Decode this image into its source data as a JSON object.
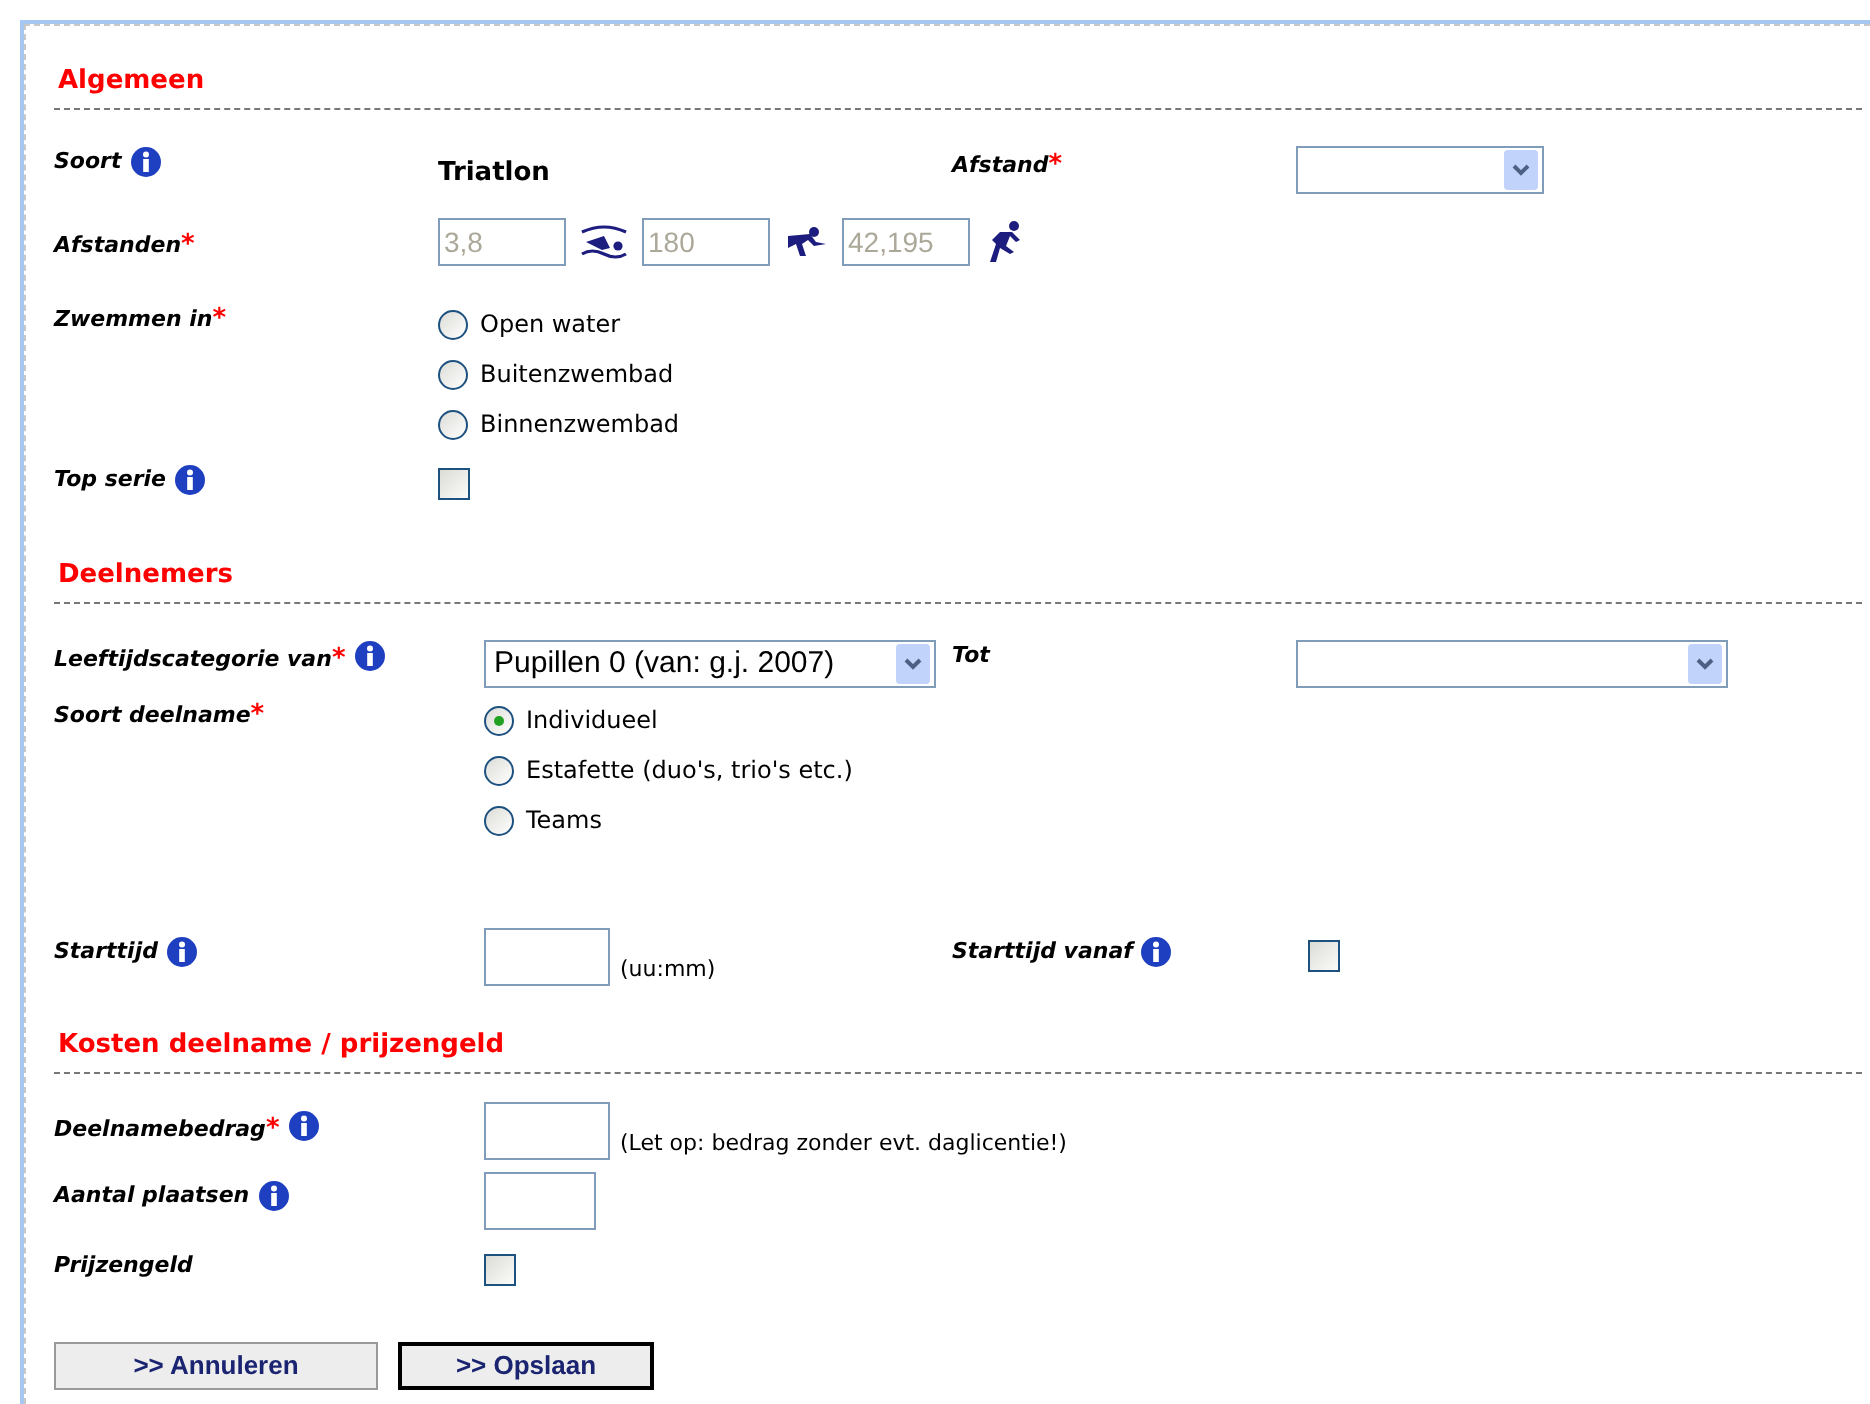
{
  "sections": [
    {
      "title": "Algemeen",
      "rows": [
        {
          "kind": "text",
          "label": "Soort",
          "info": true,
          "value": "Triatlon",
          "right": {
            "kind": "select",
            "label": "Afstand",
            "mark": "*",
            "info": false
          }
        },
        {
          "kind": "distances",
          "label": "Afstanden",
          "mark": "*",
          "info": false,
          "distances": [
            {
              "value": "3,8",
              "disabled": true
            },
            {
              "value": "180",
              "disabled": true
            },
            {
              "value": "42,195",
              "disabled": true
            }
          ]
        },
        {
          "kind": "radios",
          "label": "Zwemmen in",
          "mark": "*",
          "info": false,
          "options": [
            {
              "label": "Open water",
              "selected": false
            },
            {
              "label": "Buitenzwembad",
              "selected": false
            },
            {
              "label": "Binnenzwembad",
              "selected": false
            }
          ]
        },
        {
          "kind": "checkbox",
          "label": "Top serie",
          "info": true,
          "checked": false
        }
      ]
    },
    {
      "title": "Deelnemers",
      "rows": [
        {
          "kind": "select",
          "label": "Leeftijdscategorie van",
          "mark": "*",
          "info": true,
          "value": "Pupillen 0 (van: g.j. 2007)",
          "right": {
            "kind": "select",
            "label": "Tot",
            "info": false
          }
        },
        {
          "kind": "radios",
          "label": "Soort deelname",
          "mark": "*",
          "info": false,
          "options": [
            {
              "label": "Individueel",
              "selected": true
            },
            {
              "label": "Estafette (duo's, trio's etc.)",
              "selected": false
            },
            {
              "label": "Teams",
              "selected": false
            }
          ]
        },
        {
          "kind": "input",
          "label": "Starttijd",
          "info": true,
          "hint": "(uu:mm)",
          "right": {
            "kind": "checkbox",
            "label": "Starttijd vanaf",
            "info": true,
            "checked": false
          }
        }
      ]
    },
    {
      "title": "Kosten deelname / prijzengeld",
      "rows": [
        {
          "kind": "input",
          "label": "Deelnamebedrag",
          "mark": "*",
          "info": true,
          "hint": "(Let op: bedrag zonder evt. daglicentie!)"
        },
        {
          "kind": "input",
          "label": "Aantal plaatsen",
          "info": true
        },
        {
          "kind": "checkbox",
          "label": "Prijzengeld",
          "info": false,
          "checked": false
        }
      ]
    }
  ],
  "buttons": [
    {
      "label": ">> Annuleren",
      "primary": false
    },
    {
      "label": ">> Opslaan",
      "primary": true
    }
  ]
}
